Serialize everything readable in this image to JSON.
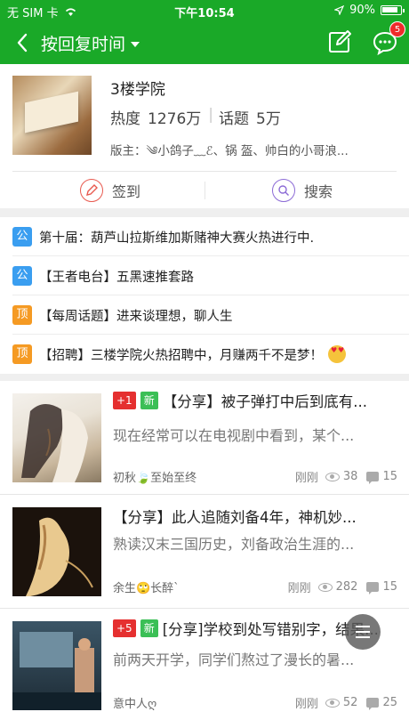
{
  "status": {
    "carrier": "无 SIM 卡",
    "time": "下午10:54",
    "battery_text": "90%",
    "battery_level": 0.9
  },
  "nav": {
    "title": "按回复时间",
    "message_badge": "5"
  },
  "forum": {
    "name": "3楼学院",
    "heat_label": "热度",
    "heat_value": "1276万",
    "topics_label": "话题",
    "topics_value": "5万",
    "moderators": "版主：༄小鸽子﹏ℰ、锅 盔、帅白的小哥浪...",
    "checkin_label": "签到",
    "search_label": "搜索"
  },
  "notices": [
    {
      "tag": "公",
      "text": "第十届：葫芦山拉斯维加斯赌神大赛火热进行中."
    },
    {
      "tag": "公",
      "text": "【王者电台】五黑速推套路"
    },
    {
      "tag": "顶",
      "text": "【每周话题】进来谈理想，聊人生"
    },
    {
      "tag": "顶",
      "text": "【招聘】三楼学院火热招聘中，月赚两千不是梦！"
    }
  ],
  "posts": [
    {
      "plus": "+1",
      "new": "新",
      "title": "【分享】被子弹打中后到底有...",
      "snippet": "现在经常可以在电视剧中看到，某个...",
      "author": "初秋🍃至始至终",
      "time": "刚刚",
      "views": "38",
      "comments": "15"
    },
    {
      "title": "【分享】此人追随刘备4年，神机妙...",
      "snippet": "熟读汉末三国历史，刘备政治生涯的...",
      "author": "余生🙄长醉`",
      "time": "刚刚",
      "views": "282",
      "comments": "15"
    },
    {
      "plus": "+5",
      "new": "新",
      "title": "[分享]学校到处写错别字，结果...",
      "snippet": "前两天开学，同学们熬过了漫长的暑...",
      "author": "意中人ღ",
      "time": "刚刚",
      "views": "52",
      "comments": "25"
    }
  ],
  "colors": {
    "brand_green": "#1aa928",
    "notice_blue": "#3a9ef0",
    "notice_orange": "#f59a23",
    "badge_red": "#e53030",
    "new_green": "#3bbf56"
  }
}
